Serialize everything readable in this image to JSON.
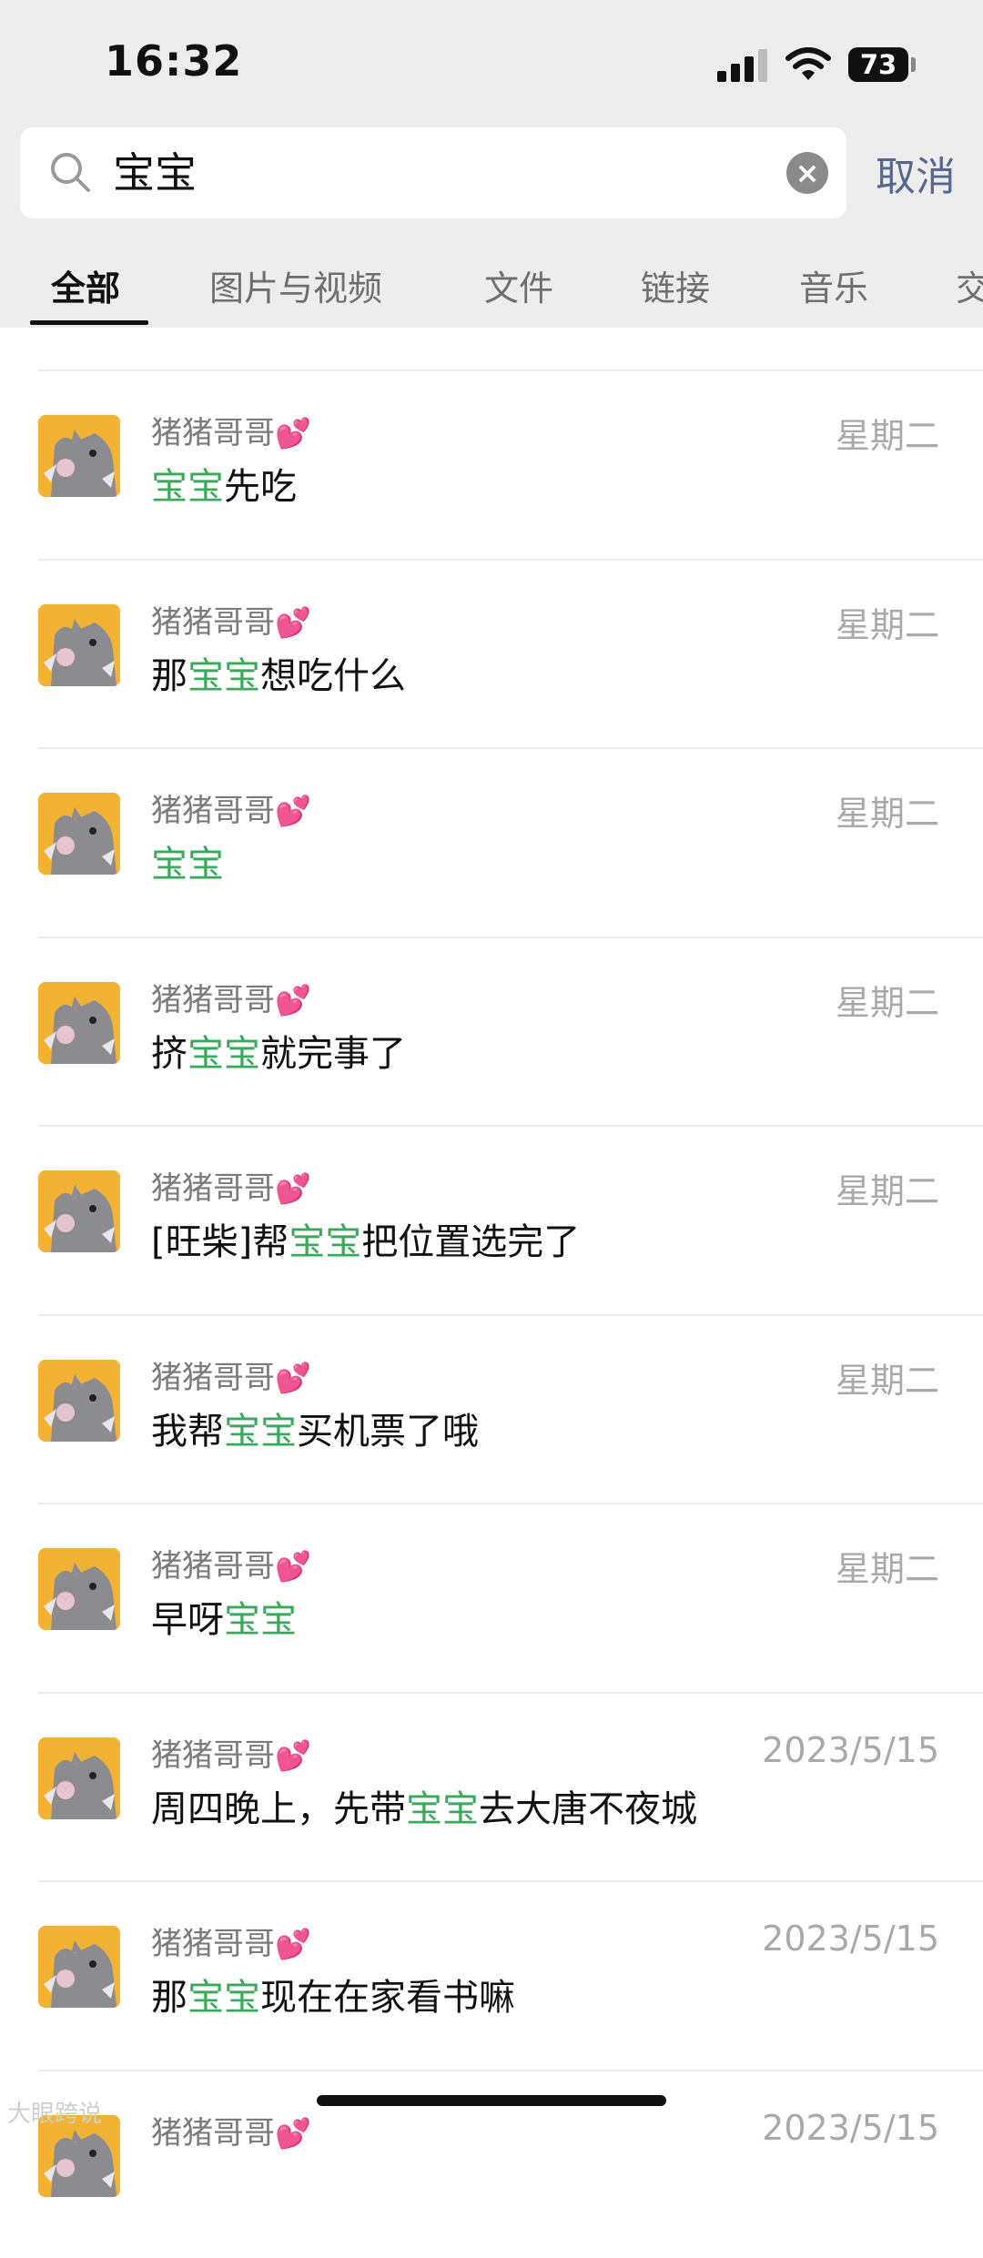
{
  "status_bar": {
    "time": "16:32",
    "battery": "73"
  },
  "search": {
    "query": "宝宝",
    "cancel_label": "取消"
  },
  "tabs": [
    {
      "label": "全部",
      "active": true
    },
    {
      "label": "图片与视频",
      "active": false
    },
    {
      "label": "文件",
      "active": false
    },
    {
      "label": "链接",
      "active": false
    },
    {
      "label": "音乐",
      "active": false
    },
    {
      "label": "交",
      "active": false
    }
  ],
  "results": [
    {
      "sender": "猪猪哥哥",
      "sender_emoji": "💕",
      "date": "星期二",
      "message": [
        {
          "t": "宝宝",
          "hl": true
        },
        {
          "t": "先吃",
          "hl": false
        }
      ]
    },
    {
      "sender": "猪猪哥哥",
      "sender_emoji": "💕",
      "date": "星期二",
      "message": [
        {
          "t": "那",
          "hl": false
        },
        {
          "t": "宝宝",
          "hl": true
        },
        {
          "t": "想吃什么",
          "hl": false
        }
      ]
    },
    {
      "sender": "猪猪哥哥",
      "sender_emoji": "💕",
      "date": "星期二",
      "message": [
        {
          "t": "宝宝",
          "hl": true
        }
      ]
    },
    {
      "sender": "猪猪哥哥",
      "sender_emoji": "💕",
      "date": "星期二",
      "message": [
        {
          "t": "挤",
          "hl": false
        },
        {
          "t": "宝宝",
          "hl": true
        },
        {
          "t": "就完事了",
          "hl": false
        }
      ]
    },
    {
      "sender": "猪猪哥哥",
      "sender_emoji": "💕",
      "date": "星期二",
      "message": [
        {
          "t": "[旺柴]帮",
          "hl": false
        },
        {
          "t": "宝宝",
          "hl": true
        },
        {
          "t": "把位置选完了",
          "hl": false
        }
      ]
    },
    {
      "sender": "猪猪哥哥",
      "sender_emoji": "💕",
      "date": "星期二",
      "message": [
        {
          "t": "我帮",
          "hl": false
        },
        {
          "t": "宝宝",
          "hl": true
        },
        {
          "t": "买机票了哦",
          "hl": false
        }
      ]
    },
    {
      "sender": "猪猪哥哥",
      "sender_emoji": "💕",
      "date": "星期二",
      "message": [
        {
          "t": "早呀",
          "hl": false
        },
        {
          "t": "宝宝",
          "hl": true
        }
      ]
    },
    {
      "sender": "猪猪哥哥",
      "sender_emoji": "💕",
      "date": "2023/5/15",
      "message": [
        {
          "t": "周四晚上，先带",
          "hl": false
        },
        {
          "t": "宝宝",
          "hl": true
        },
        {
          "t": "去大唐不夜城",
          "hl": false
        }
      ]
    },
    {
      "sender": "猪猪哥哥",
      "sender_emoji": "💕",
      "date": "2023/5/15",
      "message": [
        {
          "t": "那",
          "hl": false
        },
        {
          "t": "宝宝",
          "hl": true
        },
        {
          "t": "现在在家看书嘛",
          "hl": false
        }
      ]
    },
    {
      "sender": "猪猪哥哥",
      "sender_emoji": "💕",
      "date": "2023/5/15",
      "message": [
        {
          "t": "",
          "hl": false
        }
      ]
    }
  ],
  "watermark": "大眼跨说",
  "colors": {
    "highlight": "#3aa95c",
    "cancel": "#56688f",
    "avatar_bg": "#f2b233"
  },
  "icons": {
    "search": "search-icon",
    "clear": "clear-icon",
    "avatar": "cartoon-cat-avatar"
  }
}
